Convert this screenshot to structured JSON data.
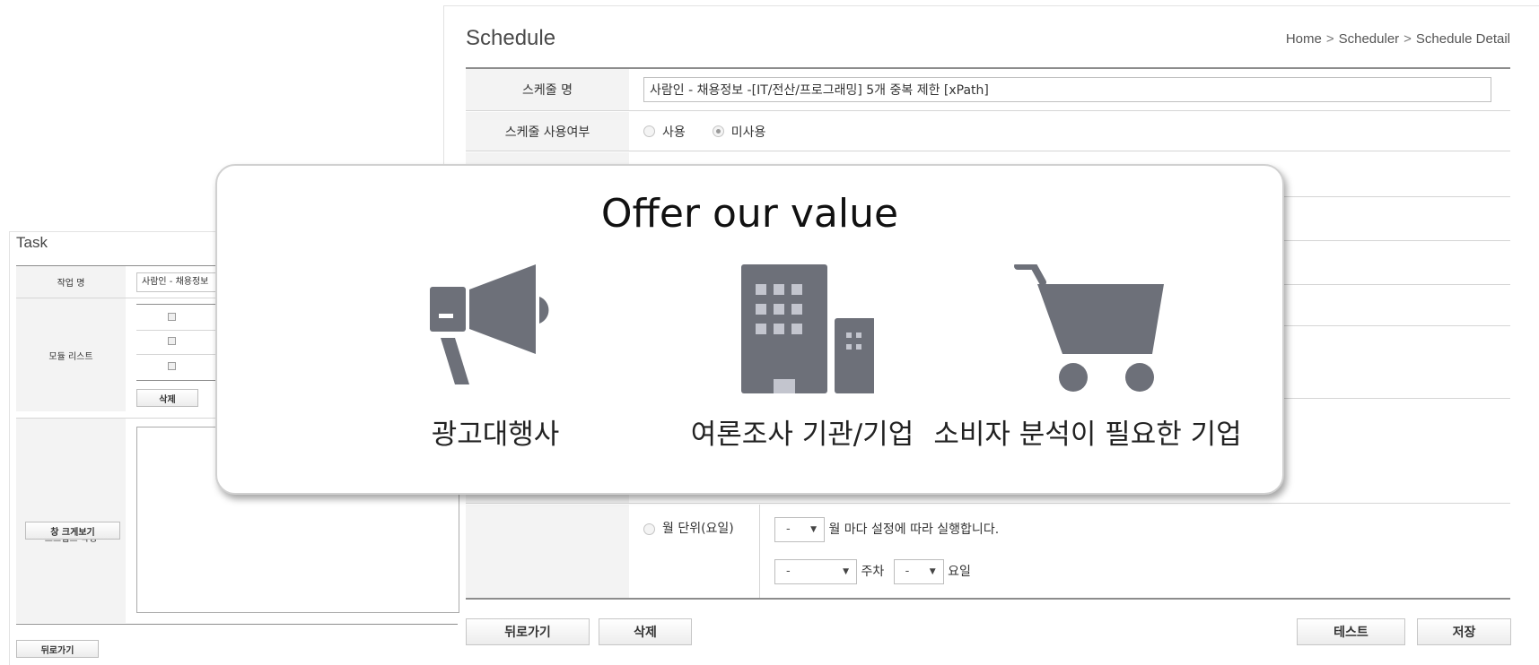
{
  "schedule": {
    "title": "Schedule",
    "breadcrumb": [
      "Home",
      "Scheduler",
      "Schedule Detail"
    ],
    "breadcrumb_sep": ">",
    "name_label": "스케줄 명",
    "name_value": "사람인 - 채용정보 -[IT/전산/프로그래밍] 5개 중복 제한 [xPath]",
    "usage_label": "스케줄 사용여부",
    "usage_options": [
      "사용",
      "미사용"
    ],
    "usage_selected": "미사용",
    "monthly_option": "월 단위(요일)",
    "month_select": "-",
    "month_text": "월 마다 설정에 따라 실행합니다.",
    "week_select": "-",
    "week_text": "주차",
    "day_select": "-",
    "day_text": "요일",
    "buttons": {
      "back": "뒤로가기",
      "delete": "삭제",
      "test": "테스트",
      "save": "저장"
    }
  },
  "task": {
    "title": "Task",
    "name_label": "작업 명",
    "name_value": "사람인 - 채용정보",
    "module_label": "모듈 리스트",
    "delete_btn": "삭제",
    "script_label": "스크립트 작성",
    "enlarge_btn": "창 크게보기",
    "back_btn": "뒤로가기"
  },
  "card": {
    "title": "Offer our value",
    "features": [
      {
        "icon": "megaphone-icon",
        "label": "광고대행사"
      },
      {
        "icon": "buildings-icon",
        "label": "여론조사 기관/기업"
      },
      {
        "icon": "shopping-cart-icon",
        "label": "소비자 분석이 필요한 기업"
      }
    ],
    "icon_color": "#6d7079"
  }
}
